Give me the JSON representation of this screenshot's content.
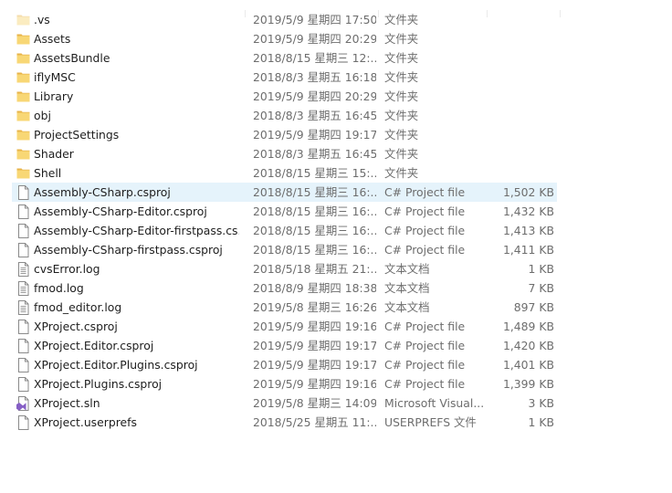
{
  "files": [
    {
      "name": ".vs",
      "date": "2019/5/9 星期四 17:50",
      "type": "文件夹",
      "size": "",
      "icon": "folder-faded-icon"
    },
    {
      "name": "Assets",
      "date": "2019/5/9 星期四 20:29",
      "type": "文件夹",
      "size": "",
      "icon": "folder-icon"
    },
    {
      "name": "AssetsBundle",
      "date": "2018/8/15 星期三 12:...",
      "type": "文件夹",
      "size": "",
      "icon": "folder-icon"
    },
    {
      "name": "iflyMSC",
      "date": "2018/8/3 星期五 16:18",
      "type": "文件夹",
      "size": "",
      "icon": "folder-icon"
    },
    {
      "name": "Library",
      "date": "2019/5/9 星期四 20:29",
      "type": "文件夹",
      "size": "",
      "icon": "folder-icon"
    },
    {
      "name": "obj",
      "date": "2018/8/3 星期五 16:45",
      "type": "文件夹",
      "size": "",
      "icon": "folder-icon"
    },
    {
      "name": "ProjectSettings",
      "date": "2019/5/9 星期四 19:17",
      "type": "文件夹",
      "size": "",
      "icon": "folder-icon"
    },
    {
      "name": "Shader",
      "date": "2018/8/3 星期五 16:45",
      "type": "文件夹",
      "size": "",
      "icon": "folder-icon"
    },
    {
      "name": "Shell",
      "date": "2018/8/15 星期三 15:...",
      "type": "文件夹",
      "size": "",
      "icon": "folder-icon"
    },
    {
      "name": "Assembly-CSharp.csproj",
      "date": "2018/8/15 星期三 16:...",
      "type": "C# Project file",
      "size": "1,502 KB",
      "icon": "document-icon",
      "hovered": true
    },
    {
      "name": "Assembly-CSharp-Editor.csproj",
      "date": "2018/8/15 星期三 16:...",
      "type": "C# Project file",
      "size": "1,432 KB",
      "icon": "document-icon"
    },
    {
      "name": "Assembly-CSharp-Editor-firstpass.cs...",
      "date": "2018/8/15 星期三 16:...",
      "type": "C# Project file",
      "size": "1,413 KB",
      "icon": "document-icon"
    },
    {
      "name": "Assembly-CSharp-firstpass.csproj",
      "date": "2018/8/15 星期三 16:...",
      "type": "C# Project file",
      "size": "1,411 KB",
      "icon": "document-icon"
    },
    {
      "name": "cvsError.log",
      "date": "2018/5/18 星期五 21:...",
      "type": "文本文档",
      "size": "1 KB",
      "icon": "text-document-icon"
    },
    {
      "name": "fmod.log",
      "date": "2018/8/9 星期四 18:38",
      "type": "文本文档",
      "size": "7 KB",
      "icon": "text-document-icon"
    },
    {
      "name": "fmod_editor.log",
      "date": "2019/5/8 星期三 16:26",
      "type": "文本文档",
      "size": "897 KB",
      "icon": "text-document-icon"
    },
    {
      "name": "XProject.csproj",
      "date": "2019/5/9 星期四 19:16",
      "type": "C# Project file",
      "size": "1,489 KB",
      "icon": "document-icon"
    },
    {
      "name": "XProject.Editor.csproj",
      "date": "2019/5/9 星期四 19:17",
      "type": "C# Project file",
      "size": "1,420 KB",
      "icon": "document-icon"
    },
    {
      "name": "XProject.Editor.Plugins.csproj",
      "date": "2019/5/9 星期四 19:17",
      "type": "C# Project file",
      "size": "1,401 KB",
      "icon": "document-icon"
    },
    {
      "name": "XProject.Plugins.csproj",
      "date": "2019/5/9 星期四 19:16",
      "type": "C# Project file",
      "size": "1,399 KB",
      "icon": "document-icon"
    },
    {
      "name": "XProject.sln",
      "date": "2019/5/8 星期三 14:09",
      "type": "Microsoft Visual...",
      "size": "3 KB",
      "icon": "visual-studio-solution-icon"
    },
    {
      "name": "XProject.userprefs",
      "date": "2018/5/25 星期五 11:...",
      "type": "USERPREFS 文件",
      "size": "1 KB",
      "icon": "document-icon"
    }
  ],
  "colors": {
    "folder": "#f8d775",
    "folder_dark": "#e8b44a",
    "hover": "#e5f3fb",
    "vs_purple": "#865fc5"
  }
}
